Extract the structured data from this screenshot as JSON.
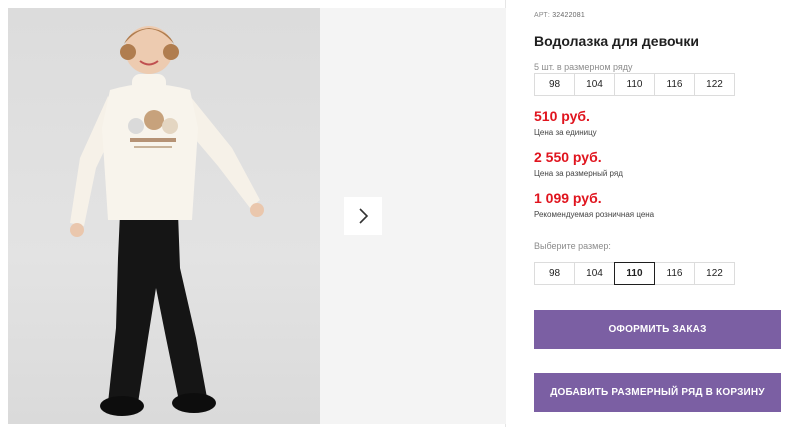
{
  "product": {
    "sku_label": "АРТ:",
    "sku_value": "32422081",
    "title": "Водолазка для девочки",
    "pack_note": "5 шт. в размерном ряду",
    "pack_sizes": [
      "98",
      "104",
      "110",
      "116",
      "122"
    ],
    "prices": [
      {
        "amount": "510 руб.",
        "caption": "Цена за единицу"
      },
      {
        "amount": "2 550 руб.",
        "caption": "Цена за размерный ряд"
      },
      {
        "amount": "1 099 руб.",
        "caption": "Рекомендуемая розничная цена"
      }
    ],
    "choose_size_label": "Выберите размер:",
    "select_sizes": [
      "98",
      "104",
      "110",
      "116",
      "122"
    ],
    "selected_size": "110"
  },
  "actions": {
    "order_label": "ОФОРМИТЬ ЗАКАЗ",
    "add_pack_label": "ДОБАВИТЬ РАЗМЕРНЫЙ РЯД В КОРЗИНУ"
  },
  "gallery": {
    "next_icon": "chevron-right-icon"
  },
  "colors": {
    "price": "#e0141e",
    "button": "#7b5fa3"
  }
}
